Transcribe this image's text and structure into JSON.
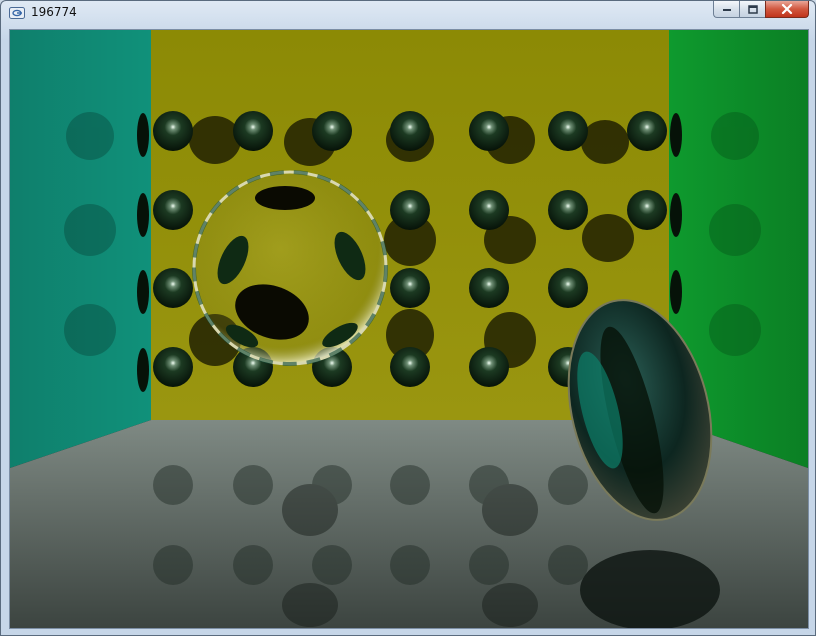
{
  "window": {
    "title": "196774",
    "icon": "app-window-icon",
    "buttons": {
      "minimize": "minimize-icon",
      "maximize": "maximize-icon",
      "close": "close-icon"
    }
  },
  "scene": {
    "description_colors": {
      "left_wall": "#0f8a73",
      "back_wall": "#8f8c06",
      "right_wall": "#0d8b2a",
      "floor": "#5a6660",
      "sphere": "#0f2a14"
    }
  }
}
